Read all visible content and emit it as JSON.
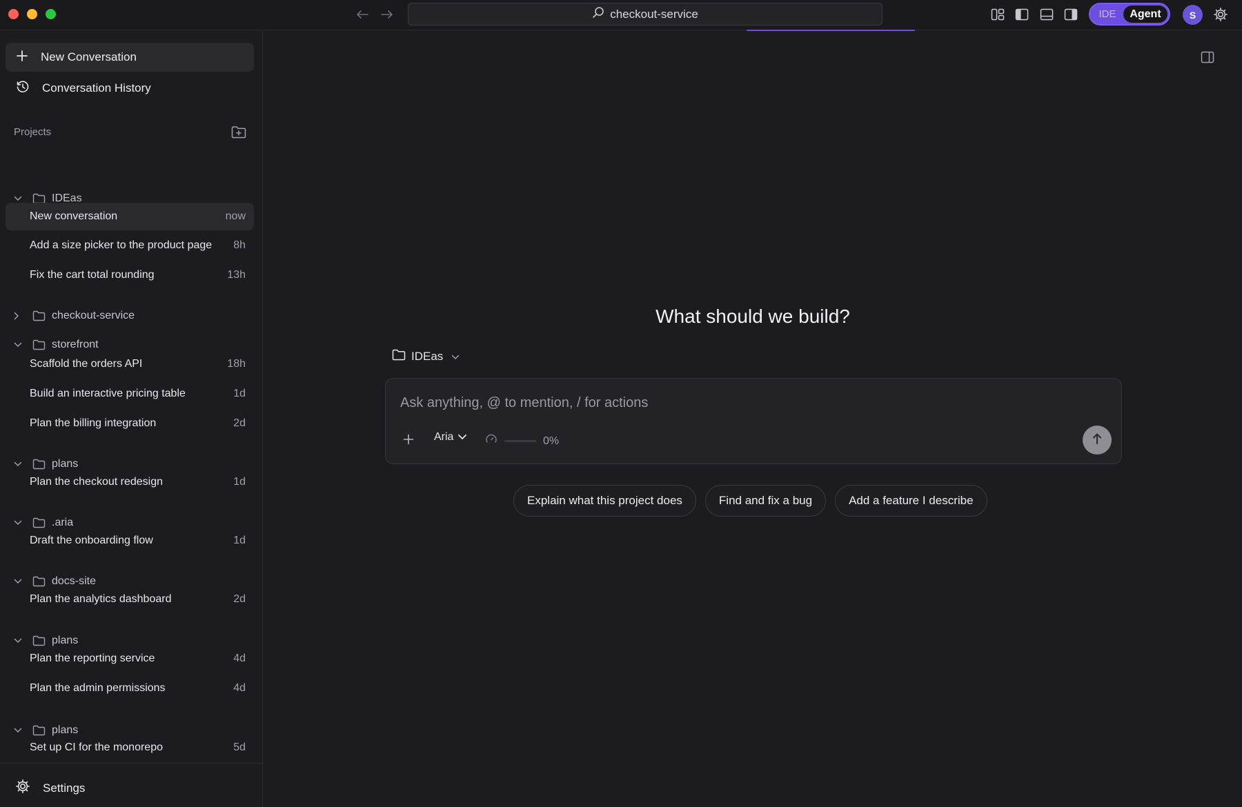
{
  "window": {
    "title": "checkout-service"
  },
  "header": {
    "search_text": "checkout-service",
    "mode_ide": "IDE",
    "mode_agent": "Agent",
    "avatar_initial": "S",
    "accent_color": "#6c4ee0"
  },
  "sidebar": {
    "new_conversation": "New Conversation",
    "history": "Conversation History",
    "projects_label": "Projects",
    "settings": "Settings",
    "tree": [
      {
        "type": "folder",
        "name": "IDEas",
        "expanded": true
      },
      {
        "type": "conv",
        "title": "New conversation",
        "time": "now",
        "active": true
      },
      {
        "type": "conv",
        "title": "Add a size picker to the product page",
        "time": "8h"
      },
      {
        "type": "conv",
        "title": "Fix the cart total rounding",
        "time": "13h"
      },
      {
        "type": "folder",
        "name": "checkout-service",
        "expanded": false
      },
      {
        "type": "folder",
        "name": "storefront",
        "expanded": true
      },
      {
        "type": "conv",
        "title": "Scaffold the orders API",
        "time": "18h"
      },
      {
        "type": "conv",
        "title": "Build an interactive pricing table",
        "time": "1d"
      },
      {
        "type": "conv",
        "title": "Plan the billing integration",
        "time": "2d"
      },
      {
        "type": "folder",
        "name": "plans",
        "expanded": true
      },
      {
        "type": "conv",
        "title": "Plan the checkout redesign",
        "time": "1d"
      },
      {
        "type": "folder",
        "name": ".aria",
        "expanded": true
      },
      {
        "type": "conv",
        "title": "Draft the onboarding flow",
        "time": "1d"
      },
      {
        "type": "folder",
        "name": "docs-site",
        "expanded": true
      },
      {
        "type": "conv",
        "title": "Plan the analytics dashboard",
        "time": "2d"
      },
      {
        "type": "folder",
        "name": "plans",
        "expanded": true
      },
      {
        "type": "conv",
        "title": "Plan the reporting service",
        "time": "4d"
      },
      {
        "type": "conv",
        "title": "Plan the admin permissions",
        "time": "4d"
      },
      {
        "type": "folder",
        "name": "plans",
        "expanded": true
      },
      {
        "type": "conv",
        "title": "Set up CI for the monorepo",
        "time": "5d"
      }
    ]
  },
  "main": {
    "headline": "What should we build?",
    "project_picker": "IDEas",
    "composer": {
      "placeholder": "Ask anything, @ to mention, / for actions",
      "model": "Aria",
      "context_usage": "0%"
    },
    "suggestions": [
      "Explain what this project does",
      "Find and fix a bug",
      "Add a feature I describe"
    ]
  }
}
